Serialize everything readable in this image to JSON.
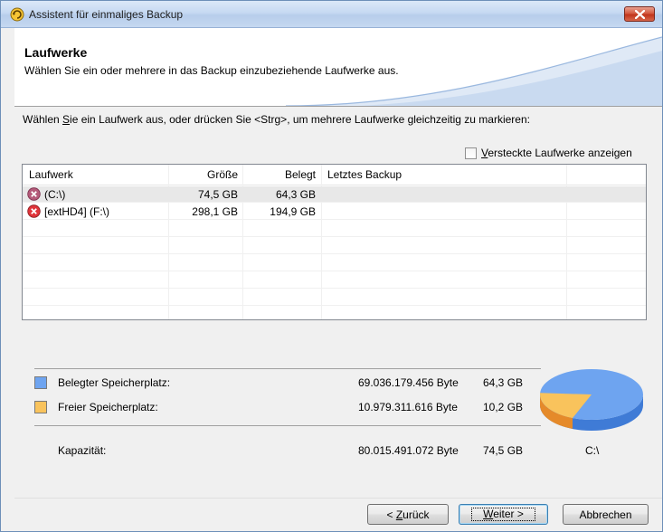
{
  "window": {
    "title": "Assistent für einmaliges Backup"
  },
  "header": {
    "title": "Laufwerke",
    "subtitle": "Wählen Sie ein oder mehrere in das Backup einzubeziehende Laufwerke aus."
  },
  "instruction": {
    "prefix": "Wählen ",
    "accel": "S",
    "suffix": "ie ein Laufwerk aus, oder drücken Sie <Strg>, um mehrere Laufwerke gleichzeitig zu markieren:"
  },
  "show_hidden": {
    "accel": "V",
    "label_rest": "ersteckte Laufwerke anzeigen",
    "checked": false
  },
  "table": {
    "columns": [
      "Laufwerk",
      "Größe",
      "Belegt",
      "Letztes Backup"
    ],
    "rows": [
      {
        "drive": "(C:\\)",
        "size": "74,5 GB",
        "used": "64,3 GB",
        "last_backup": "",
        "icon": "drive-error-icon"
      },
      {
        "drive": "[extHD4] (F:\\)",
        "size": "298,1 GB",
        "used": "194,9 GB",
        "last_backup": "",
        "icon": "drive-error-icon"
      }
    ]
  },
  "summary": {
    "used_label": "Belegter Speicherplatz:",
    "used_bytes": "69.036.179.456 Byte",
    "used_gb": "64,3 GB",
    "free_label": "Freier Speicherplatz:",
    "free_bytes": "10.979.311.616 Byte",
    "free_gb": "10,2 GB",
    "capacity_label": "Kapazität:",
    "capacity_bytes": "80.015.491.072 Byte",
    "capacity_gb": "74,5 GB",
    "pie_label": "C:\\",
    "used_color": "#6ea4f0",
    "free_color": "#f9c35c",
    "used_fraction": 0.8628
  },
  "buttons": {
    "back_accel": "Z",
    "back_prefix": "< ",
    "back_rest": "urück",
    "next_accel": "W",
    "next_rest": "eiter >",
    "cancel": "Abbrechen"
  }
}
